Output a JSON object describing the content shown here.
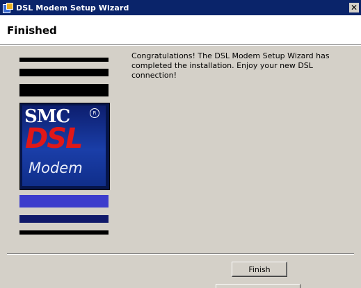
{
  "window": {
    "title": "DSL Modem Setup Wizard",
    "close_glyph": "✕"
  },
  "header": {
    "title": "Finished"
  },
  "logo": {
    "line1": "SMC",
    "registered": "R",
    "line2": "DSL",
    "line3": "Modem"
  },
  "message": {
    "text": "Congratulations!  The DSL Modem Setup Wizard has completed the installation.  Enjoy your new DSL connection!"
  },
  "buttons": {
    "finish": "Finish"
  }
}
